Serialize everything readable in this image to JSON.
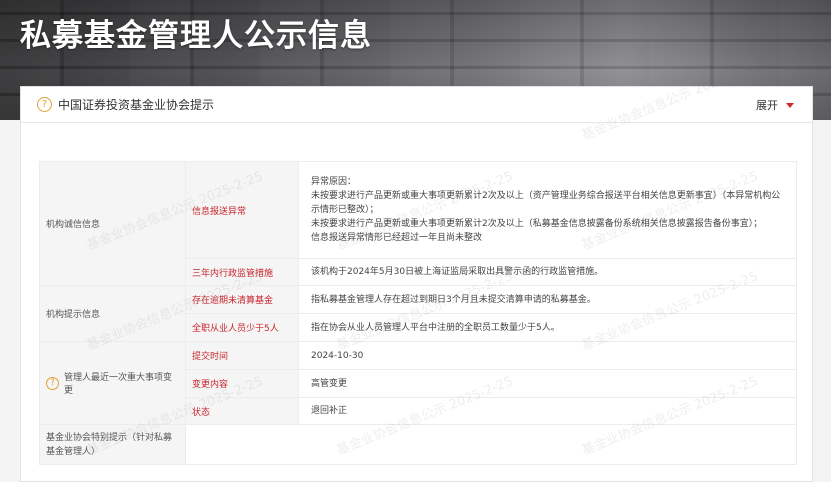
{
  "banner": {
    "title": "私募基金管理人公示信息"
  },
  "notice": {
    "title": "中国证券投资基金业协会提示",
    "expand_label": "展开"
  },
  "rows": {
    "integrity": {
      "category": "机构诚信信息",
      "label": "信息报送异常",
      "lines": [
        "异常原因：",
        "未按要求进行产品更新或重大事项更新累计2次及以上（资产管理业务综合报送平台相关信息更新事宜）（本异常机构公示情形已整改）；",
        "未按要求进行产品更新或重大事项更新累计2次及以上（私募基金信息披露备份系统相关信息披露报告备份事宜）；",
        "信息报送异常情形已经超过一年且尚未整改"
      ]
    },
    "regulatory": {
      "label": "三年内行政监管措施",
      "value": "该机构于2024年5月30日被上海证监局采取出具警示函的行政监管措施。"
    },
    "tips": {
      "category": "机构提示信息",
      "items": [
        {
          "label": "存在逾期未清算基金",
          "value": "指私募基金管理人存在超过到期日3个月且未提交清算申请的私募基金。"
        },
        {
          "label": "全职从业人员少于5人",
          "value": "指在协会从业人员管理人平台中注册的全职员工数量少于5人。"
        }
      ]
    },
    "change": {
      "category": "管理人最近一次重大事项变更",
      "items": [
        {
          "label": "提交时间",
          "value": "2024-10-30"
        },
        {
          "label": "变更内容",
          "value": "高管变更"
        },
        {
          "label": "状态",
          "value": "退回补正"
        }
      ]
    },
    "special": {
      "category": "基金业协会特别提示（针对私募基金管理人）",
      "value": ""
    }
  },
  "watermark": {
    "text": "基金业协会信息公示 2025-2-25"
  },
  "colors": {
    "accent_red": "#c8252c",
    "icon_orange": "#e0a030"
  }
}
